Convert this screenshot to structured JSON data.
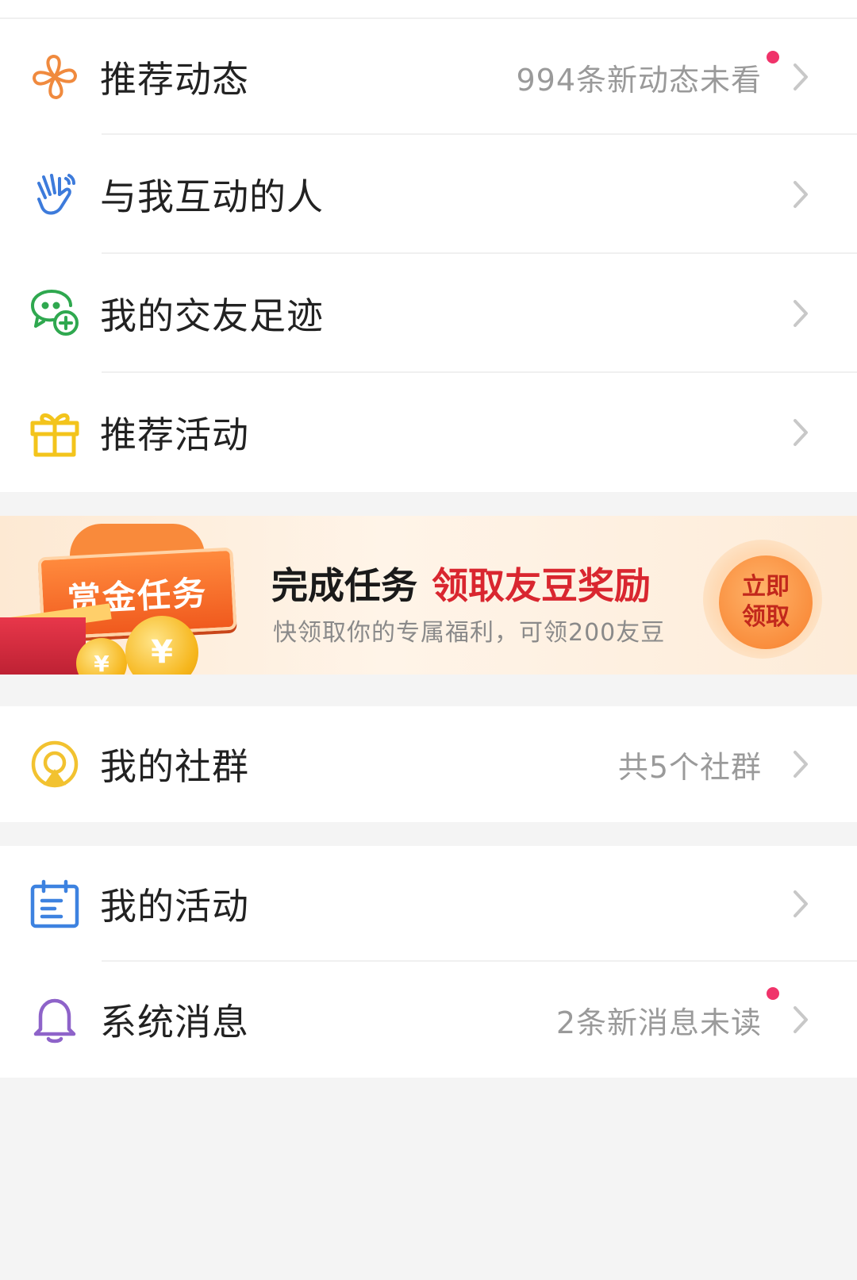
{
  "list_top": [
    {
      "label": "推荐动态",
      "right": "994条新动态未看",
      "dot": true,
      "icon": "pinwheel-icon"
    },
    {
      "label": "与我互动的人",
      "right": "",
      "dot": false,
      "icon": "waving-hand-icon"
    },
    {
      "label": "我的交友足迹",
      "right": "",
      "dot": false,
      "icon": "chat-add-icon"
    },
    {
      "label": "推荐活动",
      "right": "",
      "dot": false,
      "icon": "gift-icon"
    }
  ],
  "banner": {
    "badge": "赏金任务",
    "title_main": "完成任务",
    "title_accent": "领取友豆奖励",
    "subtitle": "快领取你的专属福利，可领200友豆",
    "button_line1": "立即",
    "button_line2": "领取",
    "coin_symbol": "¥"
  },
  "groups": {
    "label": "我的社群",
    "right": "共5个社群",
    "icon": "community-icon"
  },
  "list_bottom": [
    {
      "label": "我的活动",
      "right": "",
      "dot": false,
      "icon": "calendar-icon"
    },
    {
      "label": "系统消息",
      "right": "2条新消息未读",
      "dot": true,
      "icon": "bell-icon"
    }
  ],
  "colors": {
    "dot": "#f0336a",
    "accent_red": "#d9262f",
    "chevron": "#c8c8c8"
  }
}
